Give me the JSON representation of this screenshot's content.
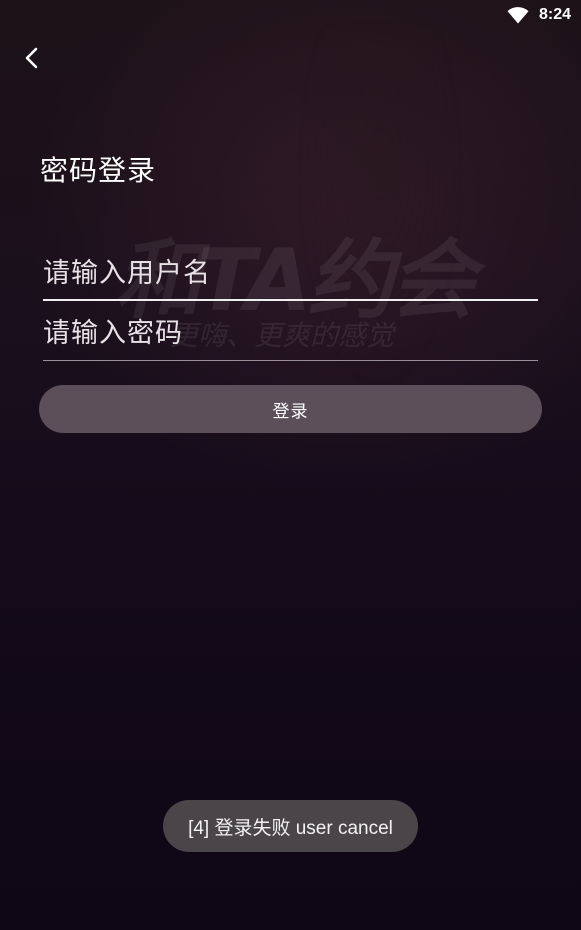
{
  "status_bar": {
    "time": "8:24",
    "wifi_icon": "wifi-icon"
  },
  "header": {
    "back_icon": "chevron-left-icon"
  },
  "watermark": {
    "main": "和TA约会",
    "sub": "更嗨、更爽的感觉"
  },
  "login_form": {
    "title": "密码登录",
    "username": {
      "value": "",
      "placeholder": "请输入用户名"
    },
    "password": {
      "value": "",
      "placeholder": "请输入密码"
    },
    "submit_label": "登录"
  },
  "toast": {
    "message": "[4] 登录失败 user cancel"
  },
  "colors": {
    "button_bg": "#5c4f59",
    "toast_bg": "#4a4548"
  }
}
